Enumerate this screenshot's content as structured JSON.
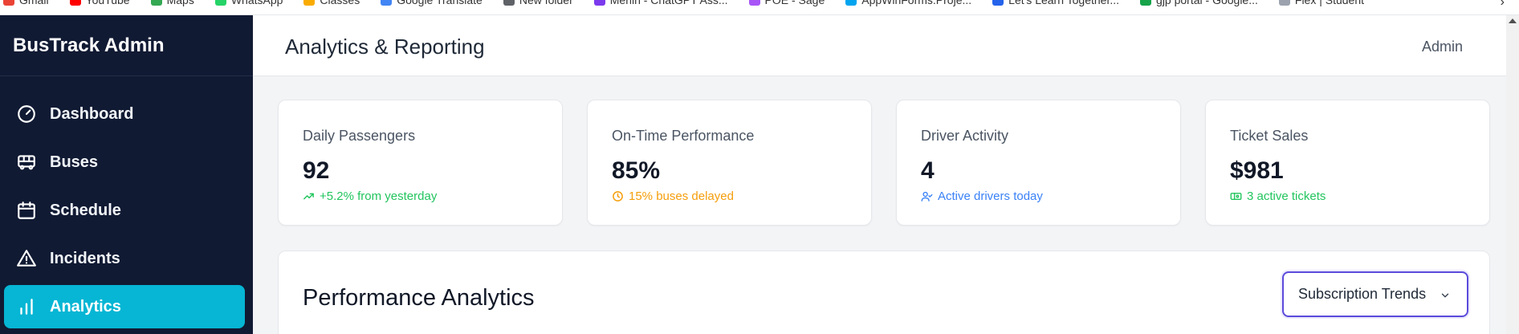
{
  "bookmarks": [
    {
      "label": "Gmail",
      "color": "#ea4335"
    },
    {
      "label": "YouTube",
      "color": "#ff0000"
    },
    {
      "label": "Maps",
      "color": "#34a853"
    },
    {
      "label": "WhatsApp",
      "color": "#25d366"
    },
    {
      "label": "Classes",
      "color": "#f9ab00"
    },
    {
      "label": "Google Translate",
      "color": "#4285f4"
    },
    {
      "label": "New folder",
      "color": "#5f6368"
    },
    {
      "label": "Merlin - ChatGPT Ass...",
      "color": "#7c3aed"
    },
    {
      "label": "POE - Sage",
      "color": "#a855f7"
    },
    {
      "label": "AppWinForms.Proje...",
      "color": "#00a4ef"
    },
    {
      "label": "Let's Learn Together...",
      "color": "#2563eb"
    },
    {
      "label": "gjp portal - Google...",
      "color": "#16a34a"
    },
    {
      "label": "Flex | Student",
      "color": "#9ca3af"
    }
  ],
  "sidebar": {
    "brand": "BusTrack Admin",
    "items": [
      {
        "label": "Dashboard",
        "icon": "gauge-icon"
      },
      {
        "label": "Buses",
        "icon": "bus-icon"
      },
      {
        "label": "Schedule",
        "icon": "calendar-icon"
      },
      {
        "label": "Incidents",
        "icon": "warning-icon"
      },
      {
        "label": "Analytics",
        "icon": "bar-chart-icon",
        "active": true
      }
    ]
  },
  "header": {
    "title": "Analytics & Reporting",
    "user": "Admin"
  },
  "stats": [
    {
      "label": "Daily Passengers",
      "value": "92",
      "sub": "+5.2% from yesterday",
      "icon": "trending-up-icon",
      "color": "#22c55e"
    },
    {
      "label": "On-Time Performance",
      "value": "85%",
      "sub": "15% buses delayed",
      "icon": "clock-icon",
      "color": "#f59e0b"
    },
    {
      "label": "Driver Activity",
      "value": "4",
      "sub": "Active drivers today",
      "icon": "user-check-icon",
      "color": "#3b82f6"
    },
    {
      "label": "Ticket Sales",
      "value": "$981",
      "sub": "3 active tickets",
      "icon": "ticket-icon",
      "color": "#22c55e"
    }
  ],
  "panel": {
    "title": "Performance Analytics",
    "select_value": "Subscription Trends"
  }
}
